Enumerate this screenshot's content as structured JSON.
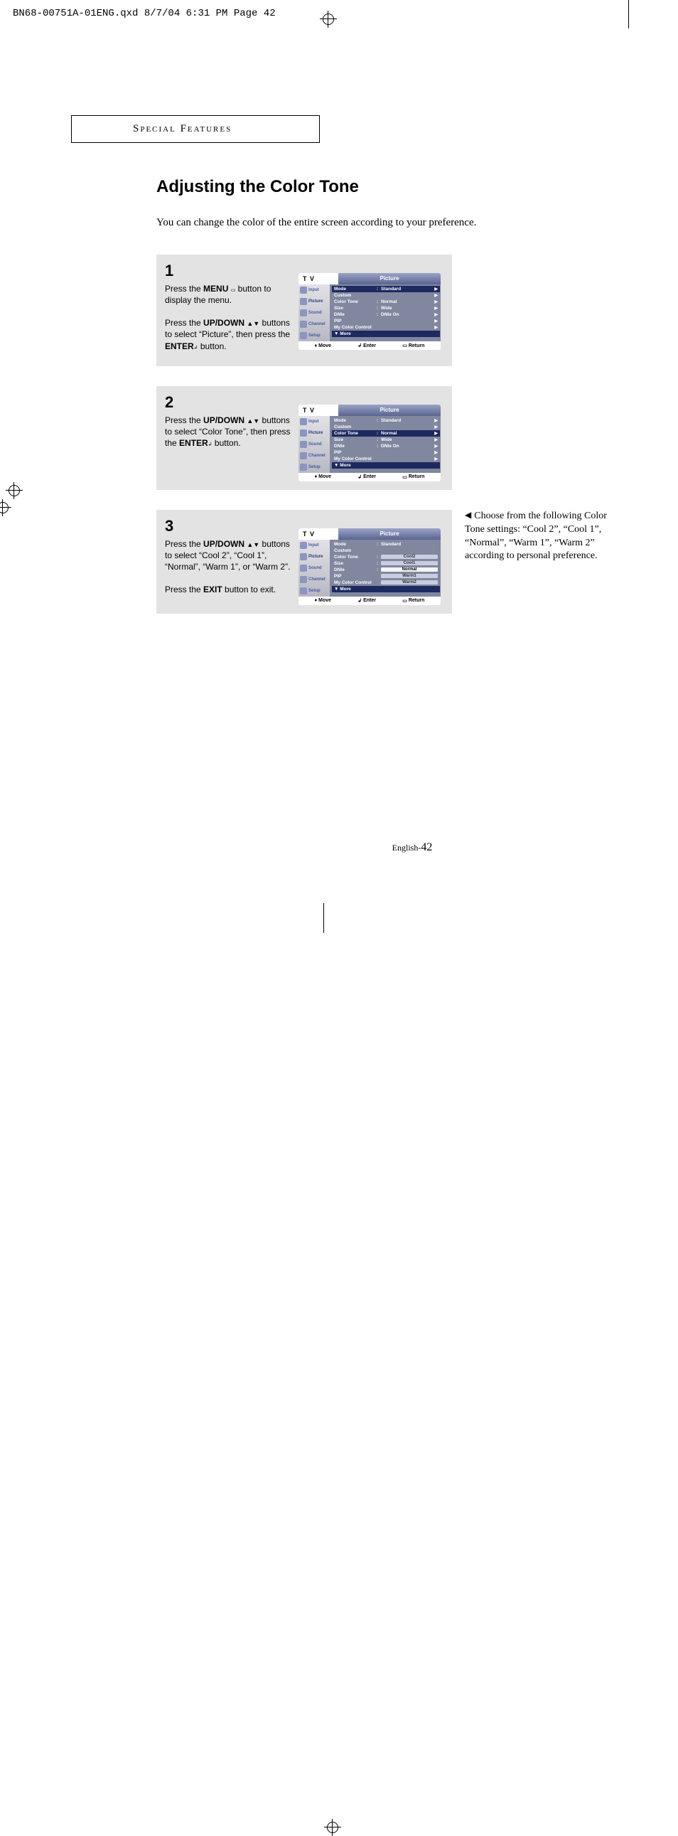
{
  "print_header": "BN68-00751A-01ENG.qxd  8/7/04 6:31 PM  Page 42",
  "section_tab": "Special Features",
  "title": "Adjusting the Color Tone",
  "intro": "You can change the color of the entire screen according to your preference.",
  "osd_common": {
    "tv_label": "T V",
    "panel_title": "Picture",
    "nav": [
      "Input",
      "Picture",
      "Sound",
      "Channel",
      "Setup"
    ],
    "footer": {
      "move": "Move",
      "enter": "Enter",
      "return": "Return"
    },
    "more_label": "More"
  },
  "steps": [
    {
      "num": "1",
      "text_html": "Press the <b>MENU</b> <span class='g'>▭</span> button to display the menu.<br><br>Press the <b>UP/DOWN</b> <span class='upar'>▲</span><span class='dnar'>▼</span> buttons to select “Picture”, then press the <b>ENTER</b><span class='g'>↲</span> button.",
      "menu_variant": "picture_root"
    },
    {
      "num": "2",
      "text_html": "Press the <b>UP/DOWN</b> <span class='upar'>▲</span><span class='dnar'>▼</span>  buttons to select “Color Tone”, then press the <b>ENTER</b><span class='g'>↲</span> button.",
      "menu_variant": "colortone_hl"
    },
    {
      "num": "3",
      "text_html": "Press the <b>UP/DOWN</b> <span class='upar'>▲</span><span class='dnar'>▼</span>  buttons to select “Cool 2”, “Cool 1”, “Normal”, “Warm 1”, or “Warm 2”.<br><br>Press the <b>EXIT</b> button to exit.",
      "menu_variant": "colortone_options"
    }
  ],
  "menu_items": {
    "mode": {
      "label": "Mode",
      "value": "Standard"
    },
    "custom": {
      "label": "Custom",
      "value": ""
    },
    "colortone": {
      "label": "Color Tone",
      "value": "Normal"
    },
    "size": {
      "label": "Size",
      "value": "Wide"
    },
    "dnie": {
      "label": "DNIe",
      "value": "DNIe On"
    },
    "pip": {
      "label": "PIP",
      "value": ""
    },
    "mycolor": {
      "label": "My Color Control",
      "value": ""
    }
  },
  "colortone_options": [
    "Cool2",
    "Cool1",
    "Normal",
    "Warm1",
    "Warm2"
  ],
  "sidenote": "Choose from the following Color Tone settings: “Cool 2”, “Cool 1”, “Normal”, “Warm 1”, “Warm 2” according to personal preference.",
  "page_number": {
    "prefix": "English-",
    "num": "42"
  }
}
